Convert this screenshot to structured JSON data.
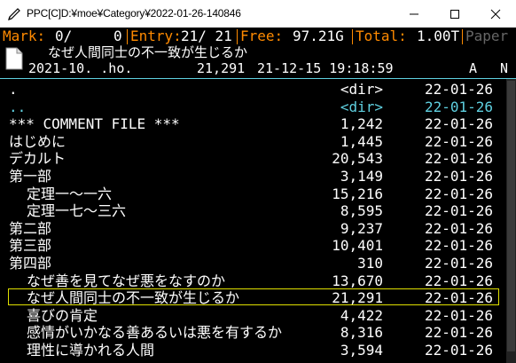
{
  "window": {
    "title": "PPC[C]D:¥moe¥Category¥2022-01-26-140846"
  },
  "infobar": {
    "mark_label": "Mark:",
    "mark_count": "0/",
    "mark_size": "0",
    "entry_label": "Entry:",
    "entry_value": "21/ 21",
    "free_label": "Free:",
    "free_value": "97.21G",
    "total_label": "Total:",
    "total_value": "1.00T",
    "paper_label": "Paper"
  },
  "infopanel": {
    "filename": "なぜ人間同士の不一致が生じるか",
    "created": "2021-10. .ho.",
    "size": "21,291",
    "modified": "21-12-15 19:18:59",
    "attr": "A",
    "flag": "N"
  },
  "files": [
    {
      "name": ".",
      "size": "<dir>",
      "date": "22-01-26",
      "indent": 0
    },
    {
      "name": "..",
      "size": "<dir>",
      "date": "22-01-26",
      "indent": 0
    },
    {
      "name": "*** COMMENT FILE ***",
      "size": "1,242",
      "date": "22-01-26",
      "indent": 0
    },
    {
      "name": "はじめに",
      "size": "1,445",
      "date": "22-01-26",
      "indent": 0
    },
    {
      "name": "デカルト",
      "size": "20,543",
      "date": "22-01-26",
      "indent": 0
    },
    {
      "name": "第一部",
      "size": "3,149",
      "date": "22-01-26",
      "indent": 0
    },
    {
      "name": "定理一～一六",
      "size": "15,216",
      "date": "22-01-26",
      "indent": 1
    },
    {
      "name": "定理一七～三六",
      "size": "8,595",
      "date": "22-01-26",
      "indent": 1
    },
    {
      "name": "第二部",
      "size": "9,237",
      "date": "22-01-26",
      "indent": 0
    },
    {
      "name": "第三部",
      "size": "10,401",
      "date": "22-01-26",
      "indent": 0
    },
    {
      "name": "第四部",
      "size": "310",
      "date": "22-01-26",
      "indent": 0
    },
    {
      "name": "なぜ善を見てなぜ悪をなすのか",
      "size": "13,670",
      "date": "22-01-26",
      "indent": 1
    },
    {
      "name": "なぜ人間同士の不一致が生じるか",
      "size": "21,291",
      "date": "22-01-26",
      "indent": 1
    },
    {
      "name": "喜びの肯定",
      "size": "4,422",
      "date": "22-01-26",
      "indent": 1
    },
    {
      "name": "感情がいかなる善あるいは悪を有するか",
      "size": "8,316",
      "date": "22-01-26",
      "indent": 1
    },
    {
      "name": "理性に導かれる人間",
      "size": "3,594",
      "date": "22-01-26",
      "indent": 1
    }
  ],
  "cursor_index": 12,
  "colors": {
    "accent_orange": "#ff8a00",
    "cyan": "#5fd0e0",
    "cursor": "#e0e000"
  },
  "icons": {
    "app": "pen-icon",
    "file": "document-icon"
  }
}
